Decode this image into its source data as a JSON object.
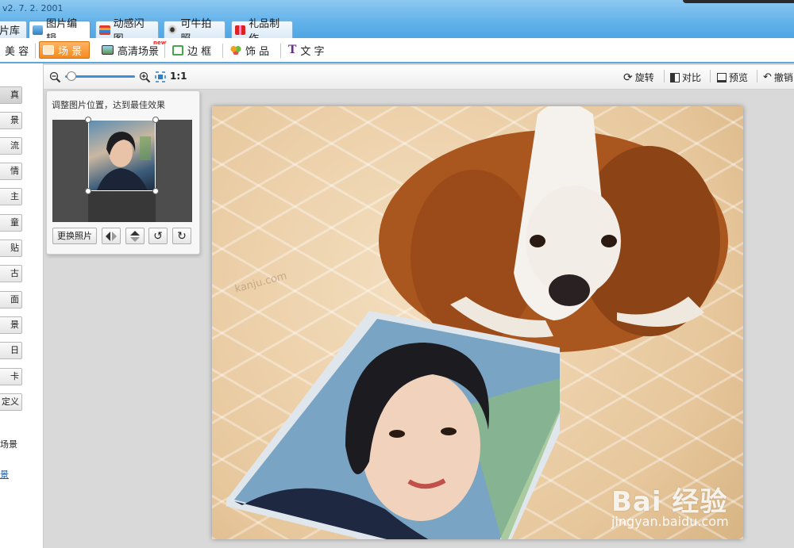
{
  "header": {
    "version": "v2. 7. 2. 2001",
    "tabs": [
      {
        "label": "片库",
        "active": false
      },
      {
        "label": "图片编辑",
        "active": true
      },
      {
        "label": "动感闪图",
        "active": false
      },
      {
        "label": "可牛拍照",
        "active": false
      },
      {
        "label": "礼品制作",
        "active": false
      }
    ]
  },
  "subtabs": [
    {
      "label": "美 容",
      "active": false
    },
    {
      "label": "场 景",
      "active": true
    },
    {
      "label": "高清场景",
      "active": false
    },
    {
      "label": "边 框",
      "active": false
    },
    {
      "label": "饰 品",
      "active": false
    },
    {
      "label": "文 字",
      "active": false
    }
  ],
  "left_panel": {
    "items": [
      "真",
      "景",
      "流",
      "情",
      "主",
      "童",
      "贴",
      "古",
      "面",
      "景",
      "日",
      "卡",
      "定义"
    ],
    "bottom_label": "场景",
    "bottom_link": "景"
  },
  "zoombar": {
    "ratio": "1:1",
    "zoom_level": 0.04,
    "rotate": "旋转",
    "compare": "对比",
    "preview": "预览",
    "undo": "撤销"
  },
  "adjust_panel": {
    "hint": "调整图片位置，达到最佳效果",
    "change_photo": "更换照片"
  },
  "canvas": {
    "floor_mark": "kanju.com",
    "watermark": "Bai 经验",
    "watermark_sub": "jingyan.baidu.com"
  },
  "colors": {
    "accent_blue": "#5aa8e0",
    "active_orange": "#f58a1f"
  }
}
